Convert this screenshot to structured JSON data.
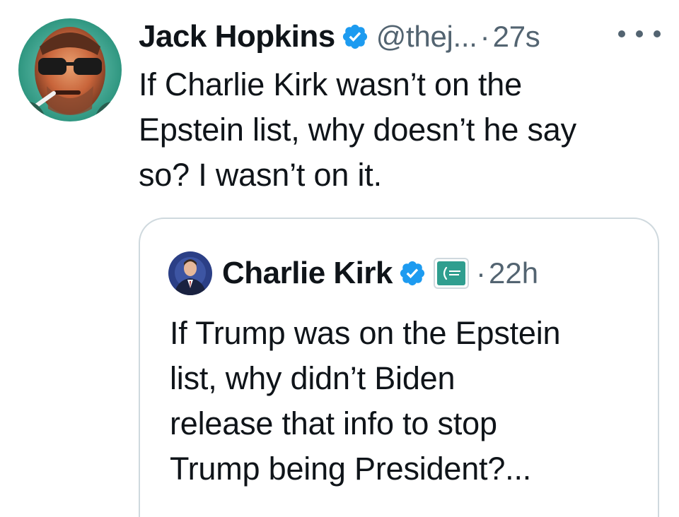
{
  "tweet": {
    "author": {
      "display_name": "Jack Hopkins",
      "handle": "@thej...",
      "verified": true,
      "avatar": "avatar-portrait-sunglasses"
    },
    "separator": "·",
    "timestamp": "27s",
    "more_icon": "more-horizontal-icon",
    "text": "If Charlie Kirk wasn’t on the\nEpstein list, why doesn’t he say\nso? I wasn’t on it."
  },
  "quoted_tweet": {
    "author": {
      "display_name": "Charlie Kirk",
      "verified": true,
      "affiliation_badge": "TURNING POINT USA",
      "avatar": "avatar-portrait-suit"
    },
    "separator": "·",
    "timestamp": "22h",
    "text": "If Trump was on the Epstein\nlist, why didn’t Biden\nrelease that info to stop\nTrump being President?..."
  },
  "colors": {
    "text_primary": "#0f1419",
    "text_secondary": "#536471",
    "verified_badge": "#1d9bf0",
    "border": "#cfd9de",
    "affiliation_bg": "#2f9e8f"
  }
}
